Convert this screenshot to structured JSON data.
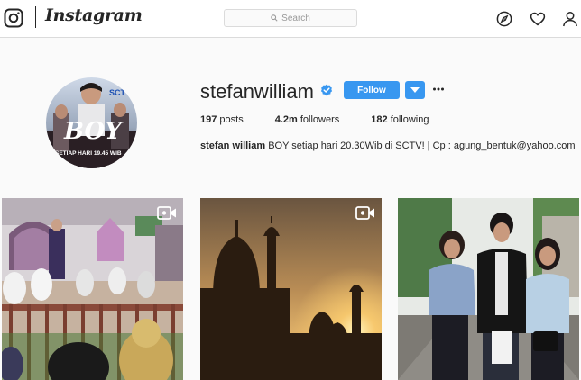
{
  "nav": {
    "brand": "Instagram",
    "logo_icon": "instagram-glyph-icon",
    "search_placeholder": "Search",
    "icons": [
      "compass-icon",
      "heart-icon",
      "person-icon"
    ]
  },
  "profile": {
    "username": "stefanwilliam",
    "verified": true,
    "follow_label": "Follow",
    "stats": {
      "posts_count": "197",
      "posts_label": "posts",
      "followers_count": "4.2m",
      "followers_label": "followers",
      "following_count": "182",
      "following_label": "following"
    },
    "bio_name": "stefan william",
    "bio_text": " BOY setiap hari 20.30Wib di SCTV! | Cp : agung_bentuk@yahoo.com",
    "avatar_text": {
      "title": "BOY",
      "channel": "SCTV",
      "tagline": "SETIAP HARI 19.45 WIB"
    }
  },
  "posts": [
    {
      "type": "video",
      "subject": "mosque-interior"
    },
    {
      "type": "video",
      "subject": "taj-mahal-sunset"
    },
    {
      "type": "image",
      "subject": "cast-group"
    }
  ],
  "colors": {
    "accent": "#3897f0",
    "verified": "#3897f0",
    "background": "#fafafa",
    "border": "#dbdbdb"
  }
}
